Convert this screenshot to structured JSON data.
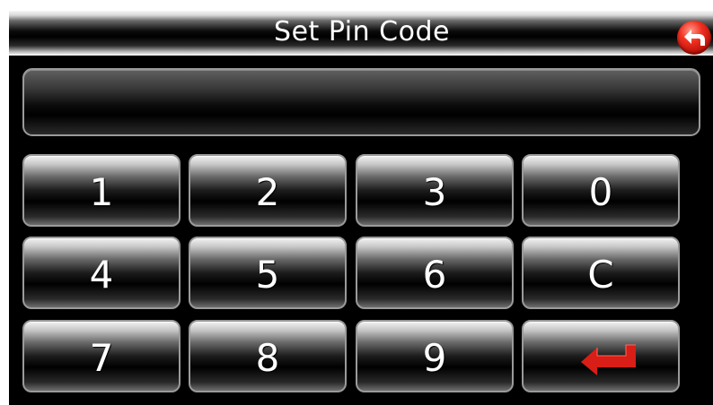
{
  "header": {
    "title": "Set Pin Code",
    "back_icon": "back-arrow-icon"
  },
  "pin_display": {
    "value": ""
  },
  "keypad": {
    "keys": [
      "1",
      "2",
      "3",
      "0",
      "4",
      "5",
      "6",
      "C",
      "7",
      "8",
      "9"
    ],
    "enter_icon": "enter-arrow-icon"
  },
  "colors": {
    "icon_red": "#e0201a",
    "background": "#000000",
    "text": "#ffffff"
  }
}
